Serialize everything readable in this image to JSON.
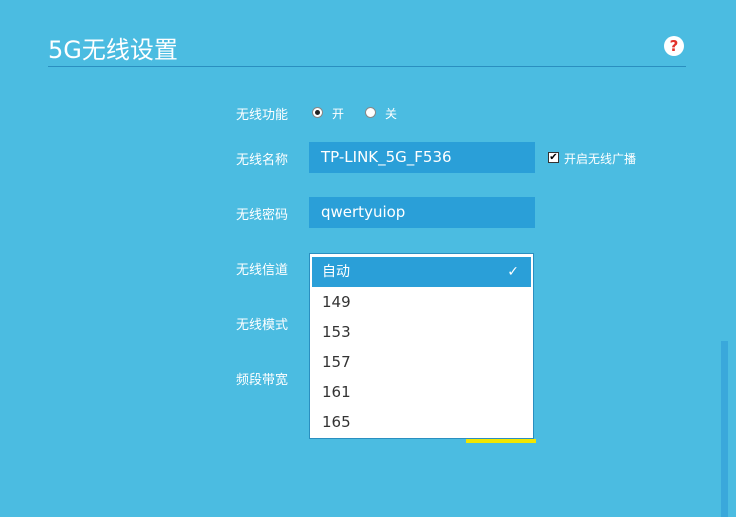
{
  "header": {
    "title": "5G无线设置",
    "help_icon": "?"
  },
  "form": {
    "wireless_function": {
      "label": "无线功能",
      "options": [
        "开",
        "关"
      ],
      "selected": "开"
    },
    "ssid": {
      "label": "无线名称",
      "value": "TP-LINK_5G_F536",
      "broadcast_label": "开启无线广播",
      "broadcast_checked": true
    },
    "password": {
      "label": "无线密码",
      "value": "qwertyuiop"
    },
    "channel": {
      "label": "无线信道",
      "selected": "自动",
      "options": [
        "149",
        "153",
        "157",
        "161",
        "165"
      ]
    },
    "mode": {
      "label": "无线模式"
    },
    "bandwidth": {
      "label": "频段带宽"
    }
  }
}
